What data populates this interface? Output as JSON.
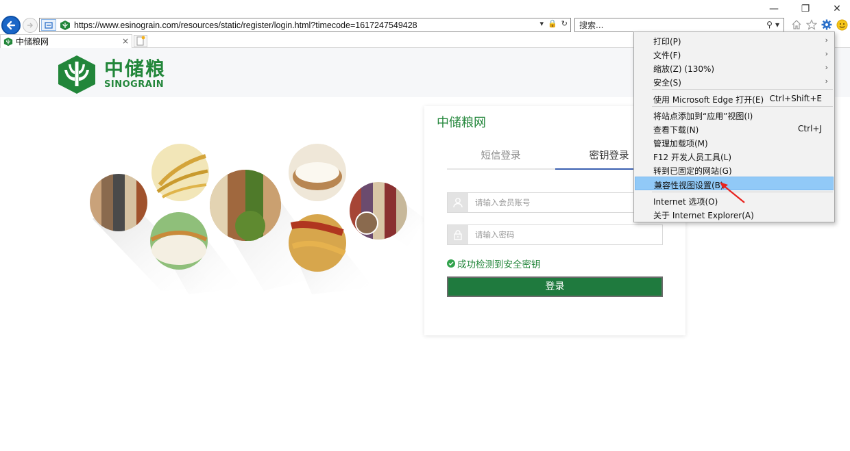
{
  "browser": {
    "url": "https://www.esinograin.com/resources/static/register/login.html?timecode=1617247549428",
    "search_placeholder": "搜索...",
    "tab_title": "中储粮网",
    "tab_close": "×"
  },
  "header": {
    "logo_cn": "中储粮",
    "logo_en": "SINOGRAIN"
  },
  "login": {
    "card_title": "中储粮网",
    "tab_sms": "短信登录",
    "tab_key": "密钥登录",
    "account_placeholder": "请输入会员账号",
    "password_placeholder": "请输入密码",
    "status_text": "成功检测到安全密钥",
    "login_button": "登录"
  },
  "menu": {
    "items": [
      {
        "label": "打印(P)",
        "submenu": true
      },
      {
        "label": "文件(F)",
        "submenu": true
      },
      {
        "label": "缩放(Z) (130%)",
        "submenu": true
      },
      {
        "label": "安全(S)",
        "submenu": true
      },
      {
        "label": "使用 Microsoft Edge 打开(E)",
        "shortcut": "Ctrl+Shift+E"
      },
      {
        "label": "将站点添加到“应用”视图(I)"
      },
      {
        "label": "查看下载(N)",
        "shortcut": "Ctrl+J"
      },
      {
        "label": "管理加载项(M)"
      },
      {
        "label": "F12 开发人员工具(L)"
      },
      {
        "label": "转到已固定的网站(G)"
      },
      {
        "label": "兼容性视图设置(B)",
        "highlighted": true
      },
      {
        "label": "Internet 选项(O)"
      },
      {
        "label": "关于 Internet Explorer(A)"
      }
    ]
  },
  "colors": {
    "brand_green": "#22863a",
    "menu_highlight": "#91c9f7",
    "nav_blue": "#1a66c7",
    "annotation_red": "#e8231e"
  }
}
